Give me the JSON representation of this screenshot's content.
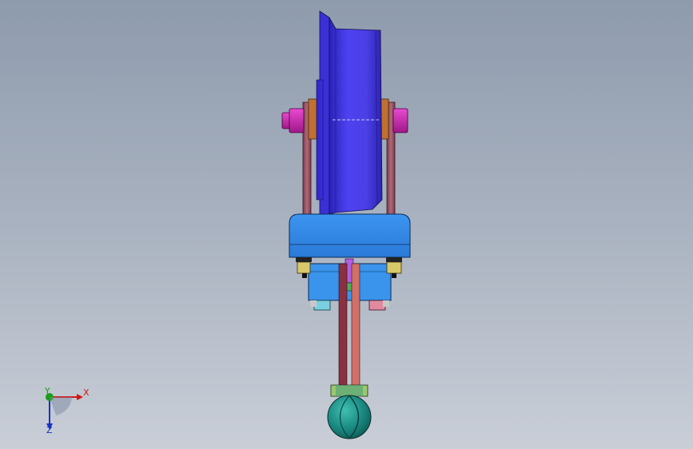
{
  "axis_triad": {
    "x_label": "X",
    "y_label": "Y",
    "z_label": "Z",
    "x_color": "#d01818",
    "y_color": "#18a018",
    "z_color": "#1830c8"
  },
  "model": {
    "wheel_color": "#4a3fe0",
    "housing_color": "#2f86e8",
    "plate_color": "#9a5a6a",
    "bolt_color": "#d22ab0",
    "ball_color": "#1f8f8a"
  }
}
